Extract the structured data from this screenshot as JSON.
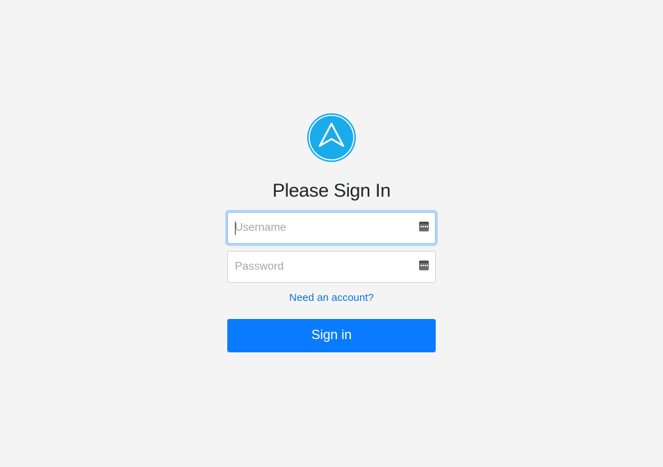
{
  "brand": {
    "logo_icon": "navigation-arrow-icon",
    "logo_color": "#1aabea"
  },
  "login": {
    "title": "Please Sign In",
    "username_placeholder": "Username",
    "username_value": "",
    "password_placeholder": "Password",
    "password_value": "",
    "field_icon": "password-manager-key-icon",
    "register_link_label": "Need an account?",
    "submit_label": "Sign in",
    "submit_color": "#0a7bff",
    "link_color": "#0a74e0"
  }
}
